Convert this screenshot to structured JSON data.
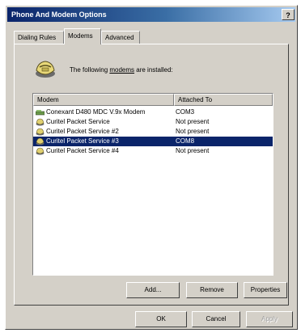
{
  "window": {
    "title": "Phone And Modem Options",
    "help_label": "?"
  },
  "tabs": [
    {
      "label": "Dialing Rules",
      "active": false
    },
    {
      "label": "Modems",
      "active": true
    },
    {
      "label": "Advanced",
      "active": false
    }
  ],
  "header": {
    "text_prefix": "The following ",
    "text_underlined": "modems",
    "text_suffix": " are installed:"
  },
  "list": {
    "columns": [
      "Modem",
      "Attached To"
    ],
    "rows": [
      {
        "modem": "Conexant D480 MDC V.9x Modem",
        "attached": "COM3",
        "icon": "modem-icon",
        "selected": false
      },
      {
        "modem": "Curitel Packet Service",
        "attached": "Not present",
        "icon": "phone-icon",
        "selected": false
      },
      {
        "modem": "Curitel Packet Service #2",
        "attached": "Not present",
        "icon": "phone-icon",
        "selected": false
      },
      {
        "modem": "Curitel Packet Service #3",
        "attached": "COM8",
        "icon": "phone-icon",
        "selected": true
      },
      {
        "modem": "Curitel Packet Service #4",
        "attached": "Not present",
        "icon": "phone-icon",
        "selected": false
      }
    ]
  },
  "actions": {
    "add": "Add...",
    "remove": "Remove",
    "properties": "Properties"
  },
  "footer": {
    "ok": "OK",
    "cancel": "Cancel",
    "apply": "Apply"
  },
  "colors": {
    "selection": "#0a246a",
    "face": "#d4d0c8",
    "title_start": "#0a246a",
    "title_end": "#a6caf0"
  }
}
